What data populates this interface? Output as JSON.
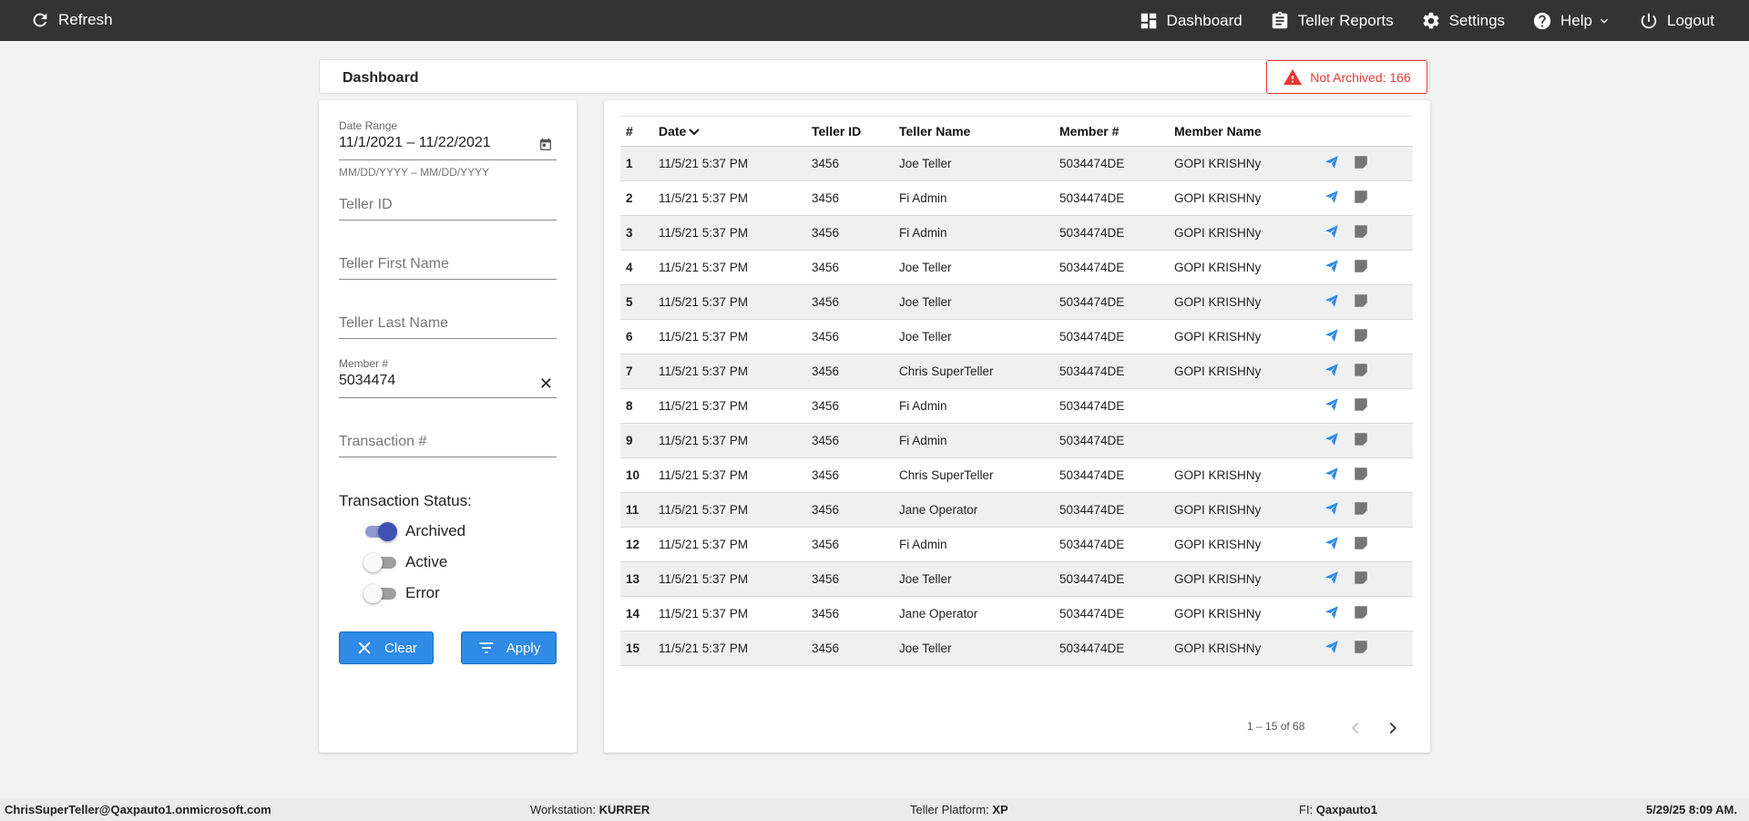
{
  "topbar": {
    "refresh_label": "Refresh",
    "dashboard_label": "Dashboard",
    "teller_reports_label": "Teller Reports",
    "settings_label": "Settings",
    "help_label": "Help",
    "logout_label": "Logout"
  },
  "header": {
    "title": "Dashboard",
    "not_archived_label": "Not Archived: 166"
  },
  "filters": {
    "date_range_label": "Date Range",
    "date_range_value": "11/1/2021 – 11/22/2021",
    "date_range_hint": "MM/DD/YYYY – MM/DD/YYYY",
    "teller_id_placeholder": "Teller ID",
    "teller_first_name_placeholder": "Teller First Name",
    "teller_last_name_placeholder": "Teller Last Name",
    "member_label": "Member #",
    "member_value": "5034474",
    "transaction_placeholder": "Transaction #",
    "status_label": "Transaction Status:",
    "statuses": [
      {
        "label": "Archived",
        "on": true
      },
      {
        "label": "Active",
        "on": false
      },
      {
        "label": "Error",
        "on": false
      }
    ],
    "clear_label": "Clear",
    "apply_label": "Apply"
  },
  "table": {
    "headers": [
      "#",
      "Date",
      "Teller ID",
      "Teller Name",
      "Member #",
      "Member Name"
    ],
    "rows": [
      [
        "1",
        "11/5/21 5:37 PM",
        "3456",
        "Joe Teller",
        "5034474DE",
        "GOPI KRISHNy"
      ],
      [
        "2",
        "11/5/21 5:37 PM",
        "3456",
        "Fi Admin",
        "5034474DE",
        "GOPI KRISHNy"
      ],
      [
        "3",
        "11/5/21 5:37 PM",
        "3456",
        "Fi Admin",
        "5034474DE",
        "GOPI KRISHNy"
      ],
      [
        "4",
        "11/5/21 5:37 PM",
        "3456",
        "Joe Teller",
        "5034474DE",
        "GOPI KRISHNy"
      ],
      [
        "5",
        "11/5/21 5:37 PM",
        "3456",
        "Joe Teller",
        "5034474DE",
        "GOPI KRISHNy"
      ],
      [
        "6",
        "11/5/21 5:37 PM",
        "3456",
        "Joe Teller",
        "5034474DE",
        "GOPI KRISHNy"
      ],
      [
        "7",
        "11/5/21 5:37 PM",
        "3456",
        "Chris SuperTeller",
        "5034474DE",
        "GOPI KRISHNy"
      ],
      [
        "8",
        "11/5/21 5:37 PM",
        "3456",
        "Fi Admin",
        "5034474DE",
        ""
      ],
      [
        "9",
        "11/5/21 5:37 PM",
        "3456",
        "Fi Admin",
        "5034474DE",
        ""
      ],
      [
        "10",
        "11/5/21 5:37 PM",
        "3456",
        "Chris SuperTeller",
        "5034474DE",
        "GOPI KRISHNy"
      ],
      [
        "11",
        "11/5/21 5:37 PM",
        "3456",
        "Jane Operator",
        "5034474DE",
        "GOPI KRISHNy"
      ],
      [
        "12",
        "11/5/21 5:37 PM",
        "3456",
        "Fi Admin",
        "5034474DE",
        "GOPI KRISHNy"
      ],
      [
        "13",
        "11/5/21 5:37 PM",
        "3456",
        "Joe Teller",
        "5034474DE",
        "GOPI KRISHNy"
      ],
      [
        "14",
        "11/5/21 5:37 PM",
        "3456",
        "Jane Operator",
        "5034474DE",
        "GOPI KRISHNy"
      ],
      [
        "15",
        "11/5/21 5:37 PM",
        "3456",
        "Joe Teller",
        "5034474DE",
        "GOPI KRISHNy"
      ]
    ],
    "row_action_icons": [
      "send-icon",
      "note-icon"
    ],
    "pagination_label": "1 – 15 of 68"
  },
  "footer": {
    "user": "ChrisSuperTeller@Qaxpauto1.onmicrosoft.com",
    "workstation_label": "Workstation:",
    "workstation_value": "KURRER",
    "platform_label": "Teller Platform:",
    "platform_value": "XP",
    "fi_label": "FI:",
    "fi_value": "Qaxpauto1",
    "datetime": "5/29/25 8:09 AM."
  },
  "colors": {
    "topbar_bg": "#333333",
    "accent_blue": "#2f8be6",
    "alert_red": "#e53935",
    "toggle_on": "#3f51b5",
    "send_icon": "#2f8be6",
    "note_icon": "#757575"
  }
}
